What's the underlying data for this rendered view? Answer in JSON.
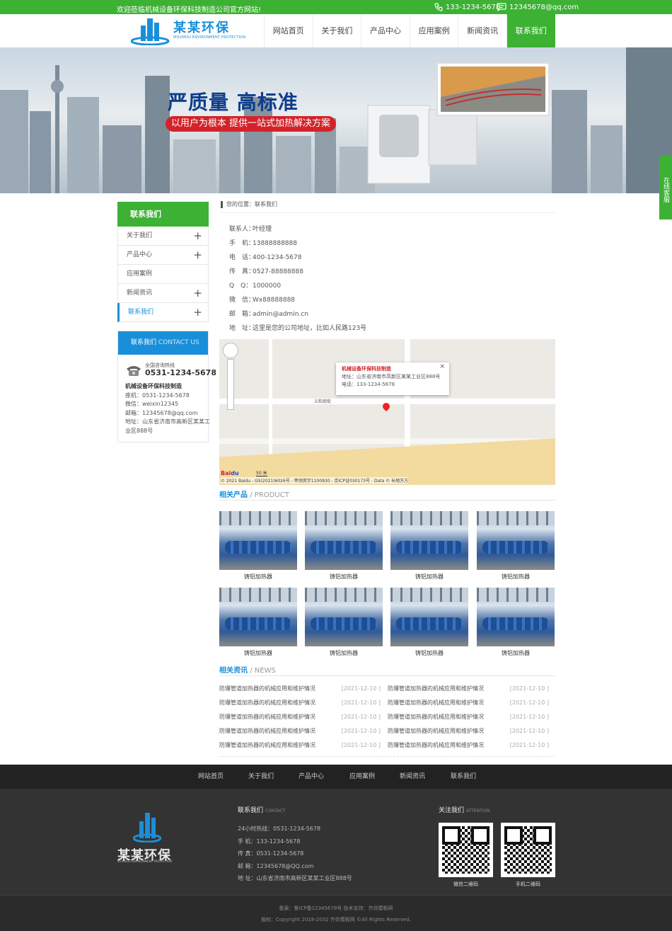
{
  "topbar": {
    "welcome": "欢迎莅临机械设备环保科技制造公司官方网站!",
    "phone": "133-1234-5678",
    "email": "12345678@qq.com"
  },
  "header": {
    "brand": "某某环保",
    "brand_sub": "MOUMOU ENVIRONMENT PROTECTION",
    "nav": [
      "网站首页",
      "关于我们",
      "产品中心",
      "应用案例",
      "新闻资讯",
      "联系我们"
    ],
    "active_nav": "联系我们"
  },
  "banner": {
    "slogan": "严质量 高标准",
    "tagline": "以用户为根本 提供一站式加热解决方案"
  },
  "online_service": "在线客服",
  "sidebar": {
    "title": "联系我们",
    "items": [
      {
        "label": "关于我们",
        "expandable": true
      },
      {
        "label": "产品中心",
        "expandable": true
      },
      {
        "label": "应用案例",
        "expandable": false
      },
      {
        "label": "新闻资讯",
        "expandable": true
      },
      {
        "label": "联系我们",
        "expandable": true
      }
    ],
    "contact": {
      "title": "联系我们",
      "title_en": "CONTACT US",
      "hotline_label": "全国咨询热线",
      "hotline": "0531-1234-5678",
      "company": "机械设备环保科技制造",
      "lines": [
        "座机：0531-1234-5678",
        "微信：weixin12345",
        "邮箱：12345678@qq.com",
        "地址：山东省济南市高新区某某工",
        "业区888号"
      ]
    }
  },
  "main": {
    "breadcrumb": "您的位置：联系我们",
    "contact_list": [
      {
        "key": "联系人：",
        "value": "叶经理"
      },
      {
        "key": "手　机：",
        "value": "13888888888"
      },
      {
        "key": "电　话：",
        "value": "400-1234-5678"
      },
      {
        "key": "传　真：",
        "value": "0527-88888888"
      },
      {
        "key": "Q　Q：",
        "value": "1000000"
      },
      {
        "key": "微　信：",
        "value": "Wx88888888"
      },
      {
        "key": "邮　箱：",
        "value": "admin@admin.cn"
      },
      {
        "key": "地　址：",
        "value": "这里是您的公司地址，比如人民路123号"
      }
    ],
    "map": {
      "popup_title": "机械设备环保科技制造",
      "popup_address": "地址：山东省济南市高新区某某工业区888号",
      "popup_phone": "电话：133-1234-5678",
      "street": "义和南街",
      "scale": "50 米",
      "copyright": "© 2021 Baidu - GS(2021)6026号 - 甲测资字1100930 - 京ICP证030173号 - Data © 长地万方"
    },
    "products_section": {
      "title": "相关产品",
      "title_en": "/ PRODUCT"
    },
    "products": [
      "铸铝加热器",
      "铸铝加热器",
      "铸铝加热器",
      "铸铝加热器",
      "铸铝加热器",
      "铸铝加热器",
      "铸铝加热器",
      "铸铝加热器"
    ],
    "news_section": {
      "title": "相关资讯",
      "title_en": "/ NEWS"
    },
    "news": [
      {
        "title": "防爆管道加热器的机械应用和维护情况",
        "date": "[2021-12-10 ]"
      },
      {
        "title": "防爆管道加热器的机械应用和维护情况",
        "date": "[2021-12-10 ]"
      },
      {
        "title": "防爆管道加热器的机械应用和维护情况",
        "date": "[2021-12-10 ]"
      },
      {
        "title": "防爆管道加热器的机械应用和维护情况",
        "date": "[2021-12-10 ]"
      },
      {
        "title": "防爆管道加热器的机械应用和维护情况",
        "date": "[2021-12-10 ]"
      },
      {
        "title": "防爆管道加热器的机械应用和维护情况",
        "date": "[2021-12-10 ]"
      },
      {
        "title": "防爆管道加热器的机械应用和维护情况",
        "date": "[2021-12-10 ]"
      },
      {
        "title": "防爆管道加热器的机械应用和维护情况",
        "date": "[2021-12-10 ]"
      },
      {
        "title": "防爆管道加热器的机械应用和维护情况",
        "date": "[2021-12-10 ]"
      },
      {
        "title": "防爆管道加热器的机械应用和维护情况",
        "date": "[2021-12-10 ]"
      }
    ]
  },
  "footer": {
    "nav": [
      "网站首页",
      "关于我们",
      "产品中心",
      "应用案例",
      "新闻资讯",
      "联系我们"
    ],
    "brand": "某某环保",
    "brand_sub": "MOUMOU ENVIRONMENT PROTECTION",
    "contact_title": "联系我们",
    "contact_title_en": "CONTACT",
    "contact_lines": [
      "24小时热线：0531-1234-5678",
      "手 机：133-1234-5678",
      "传 真：0531-1234-5678",
      "邮 箱：12345678@QQ.com",
      "地 址：山东省济南市高新区某某工业区888号"
    ],
    "follow_title": "关注我们",
    "follow_title_en": "ATTENTION",
    "qr_captions": [
      "微信二维码",
      "手机二维码"
    ],
    "icp": "备案：鲁ICP备12345678号 技术支持：齐优模板网",
    "copyright": "版权：Copyright 2018-2032 齐优模板网 ©All Rights Reserved."
  },
  "colors": {
    "green": "#3cb134",
    "blue": "#1a8fd9",
    "footer_dark": "#333333"
  }
}
